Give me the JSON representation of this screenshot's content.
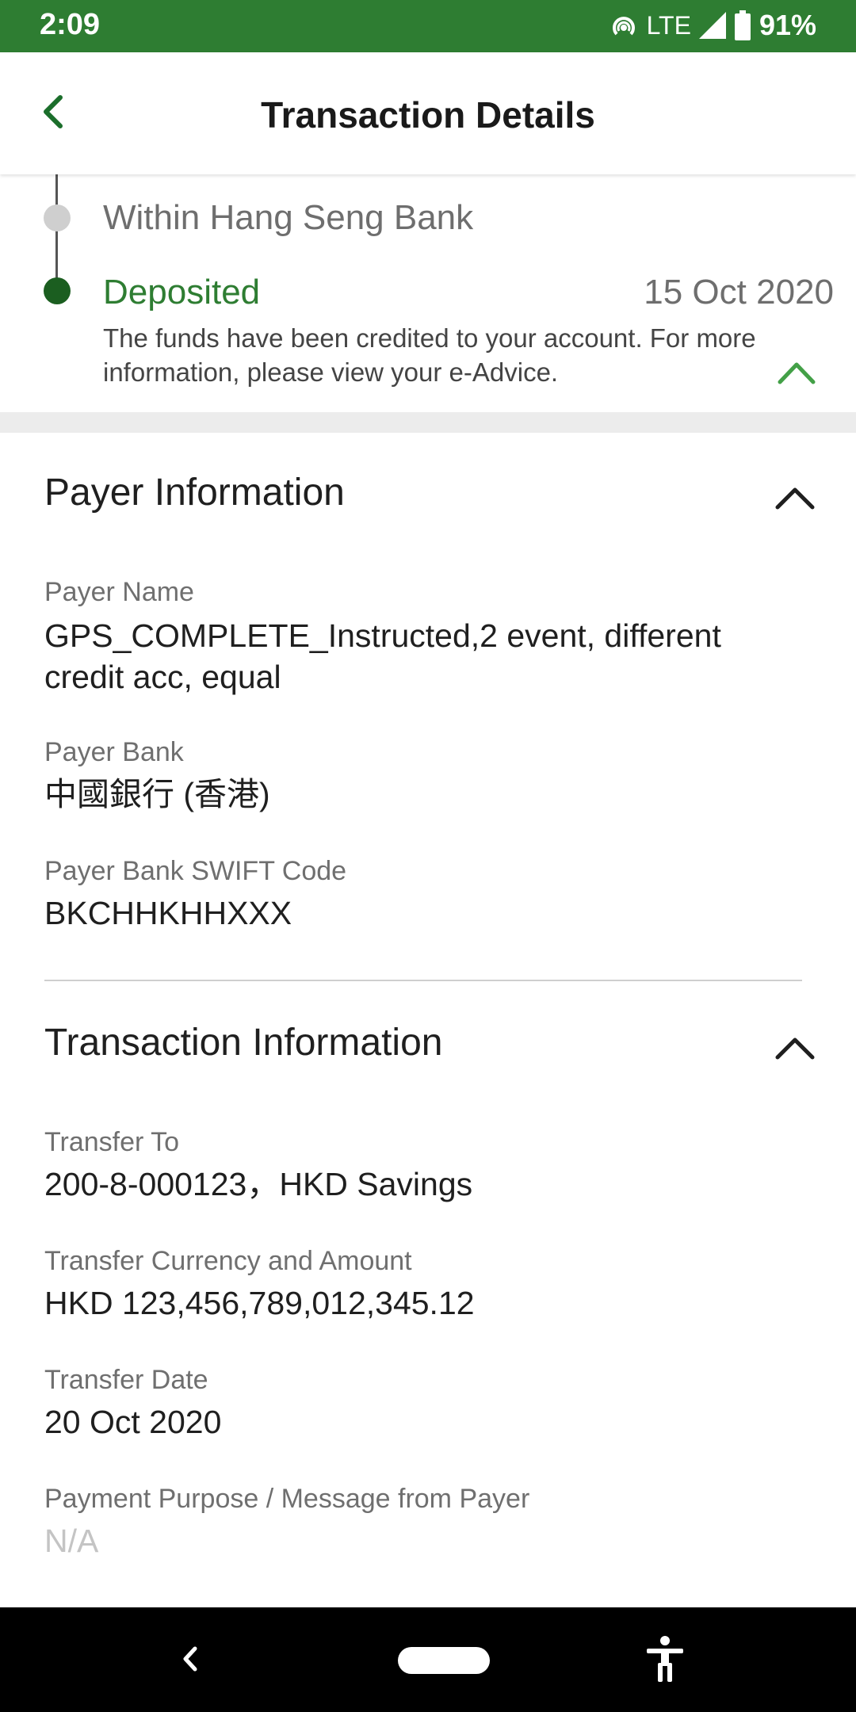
{
  "status_bar": {
    "time": "2:09",
    "network": "LTE",
    "battery": "91%",
    "icons": [
      "hotspot-icon",
      "signal-icon",
      "battery-icon"
    ]
  },
  "app_bar": {
    "title": "Transaction Details",
    "back_icon": "chevron-left-icon"
  },
  "timeline": {
    "steps": [
      {
        "label": "Within Hang Seng Bank",
        "date": ""
      },
      {
        "label": "Deposited",
        "date": "15 Oct 2020"
      }
    ],
    "description": "The funds have been credited to your account. For more information, please view your e-Advice."
  },
  "payer_section": {
    "title": "Payer Information",
    "fields": [
      {
        "label": "Payer Name",
        "value": "GPS_COMPLETE_Instructed,2 event, different credit acc, equal"
      },
      {
        "label": "Payer Bank",
        "value": "中國銀行 (香港)"
      },
      {
        "label": "Payer Bank SWIFT Code",
        "value": "BKCHHKHHXXX"
      }
    ]
  },
  "transaction_section": {
    "title": "Transaction Information",
    "fields": [
      {
        "label": "Transfer To",
        "value": "200-8-000123，HKD Savings"
      },
      {
        "label": "Transfer Currency and Amount",
        "value": "HKD 123,456,789,012,345.12"
      },
      {
        "label": "Transfer Date",
        "value": "20 Oct 2020"
      },
      {
        "label": "Payment Purpose / Message from Payer",
        "value": "N/A"
      }
    ]
  },
  "colors": {
    "brand_green": "#2e7d32",
    "dark_green": "#1b5e20",
    "accent_green": "#43a047"
  }
}
